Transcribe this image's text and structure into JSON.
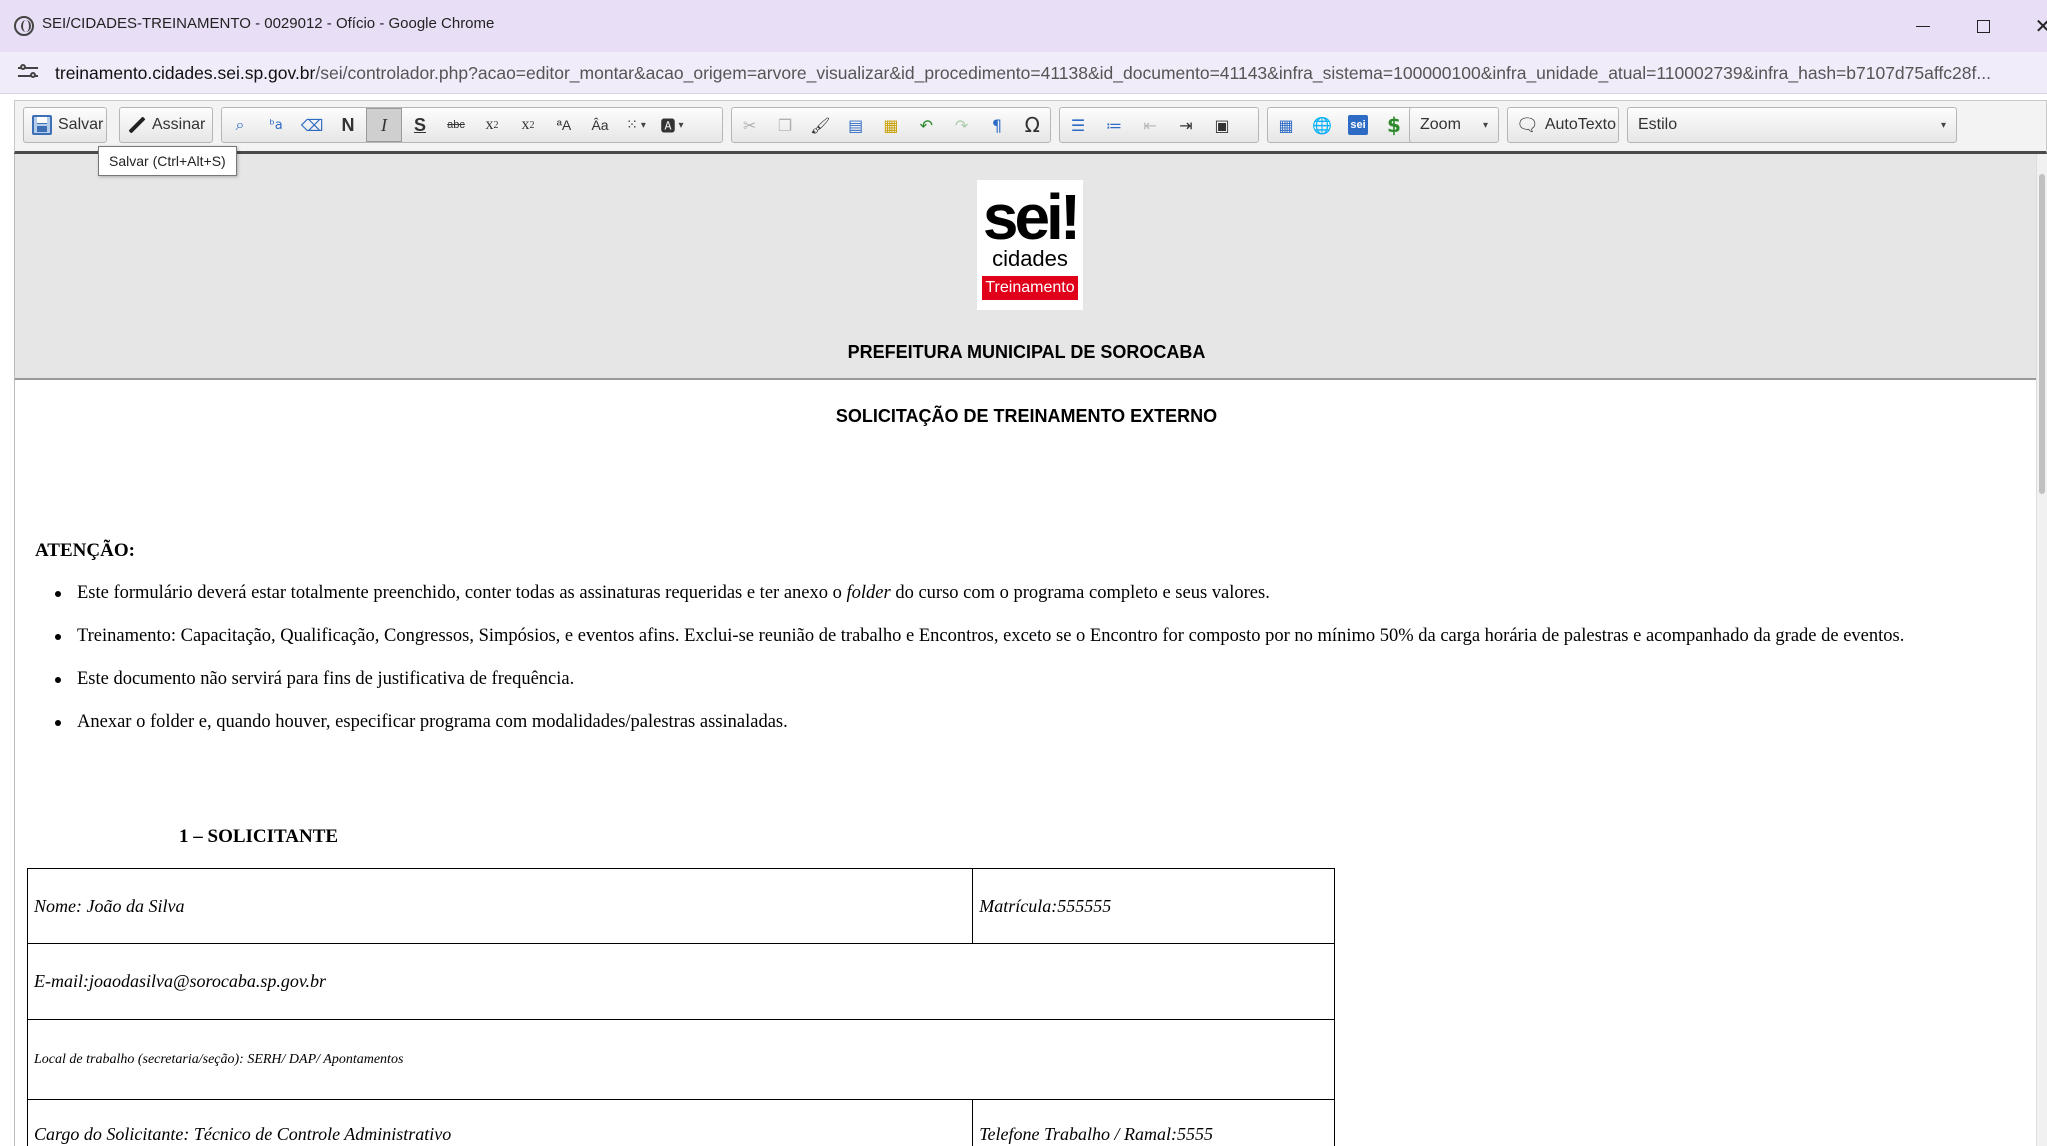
{
  "browser": {
    "title": "SEI/CIDADES-TREINAMENTO - 0029012 - Ofício - Google Chrome",
    "url_host": "treinamento.cidades.sei.sp.gov.br",
    "url_path": "/sei/controlador.php?acao=editor_montar&acao_origem=arvore_visualizar&id_procedimento=41138&id_documento=41143&infra_sistema=100000100&infra_unidade_atual=110002739&infra_hash=b7107d75affc28f..."
  },
  "toolbar": {
    "save_label": "Salvar",
    "sign_label": "Assinar",
    "bold_label": "N",
    "italic_label": "I",
    "strike_label": "S",
    "zoom_label": "Zoom",
    "autotext_label": "AutoTexto",
    "style_label": "Estilo",
    "save_tooltip": "Salvar (Ctrl+Alt+S)"
  },
  "document": {
    "logo_main": "sei!",
    "logo_sub": "cidades",
    "logo_badge": "Treinamento",
    "org_name": "PREFEITURA MUNICIPAL DE SOROCABA",
    "title": "SOLICITAÇÃO DE TREINAMENTO EXTERNO",
    "attention_heading": "ATENÇÃO:",
    "bullet1_before": "Este formulário deverá estar totalmente preenchido, conter todas as assinaturas requeridas e ter anexo o ",
    "bullet1_em": "folder",
    "bullet1_after": " do curso com o programa completo e seus valores.",
    "bullet2": "Treinamento: Capacitação, Qualificação, Congressos, Simpósios, e eventos afins. Exclui-se reunião de trabalho e Encontros, exceto se o Encontro for composto por no mínimo 50% da carga horária de palestras e acompanhado da grade de eventos.",
    "bullet3": "Este documento não servirá para fins de justificativa de frequência.",
    "bullet4": "Anexar o folder e, quando houver, especificar programa com modalidades/palestras assinaladas.",
    "section1_heading": "1 – SOLICITANTE",
    "form": {
      "nome": "Nome: João da Silva",
      "matricula": "Matrícula:555555",
      "email": "E-mail:joaodasilva@sorocaba.sp.gov.br",
      "local": "Local de trabalho (secretaria/seção): SERH/ DAP/ Apontamentos",
      "cargo": "Cargo do Solicitante: Técnico de Controle Administrativo",
      "telefone": "Telefone Trabalho / Ramal:5555"
    }
  },
  "colors": {
    "titlebar_bg": "#e8def5",
    "badge_red": "#e0001a",
    "arrow_red": "#e00000"
  }
}
